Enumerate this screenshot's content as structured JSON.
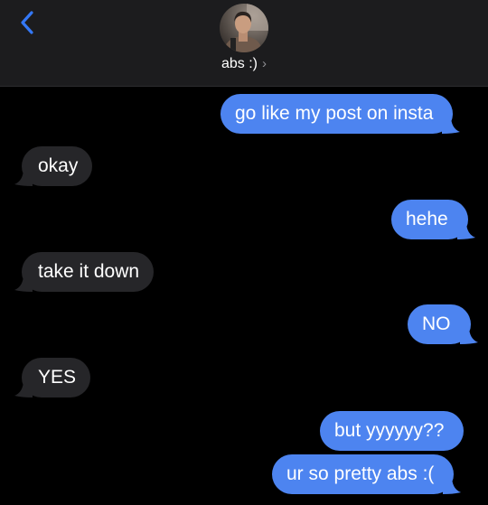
{
  "contact": {
    "name": "abs :)",
    "chevron": "›"
  },
  "icons": {
    "back": "chevron-left-icon",
    "detail": "chevron-right-icon"
  },
  "colors": {
    "accent": "#3478f6",
    "outgoing_bubble": "#4d84f0",
    "incoming_bubble": "#262629",
    "header_bg": "#1c1c1e"
  },
  "messages": [
    {
      "direction": "outgoing",
      "text": "go like my post on insta"
    },
    {
      "direction": "incoming",
      "text": "okay"
    },
    {
      "direction": "outgoing",
      "text": "hehe"
    },
    {
      "direction": "incoming",
      "text": "take it down"
    },
    {
      "direction": "outgoing",
      "text": "NO"
    },
    {
      "direction": "incoming",
      "text": "YES"
    },
    {
      "direction": "outgoing",
      "text": "but yyyyyy??"
    },
    {
      "direction": "outgoing",
      "text": "ur so pretty abs :("
    }
  ]
}
